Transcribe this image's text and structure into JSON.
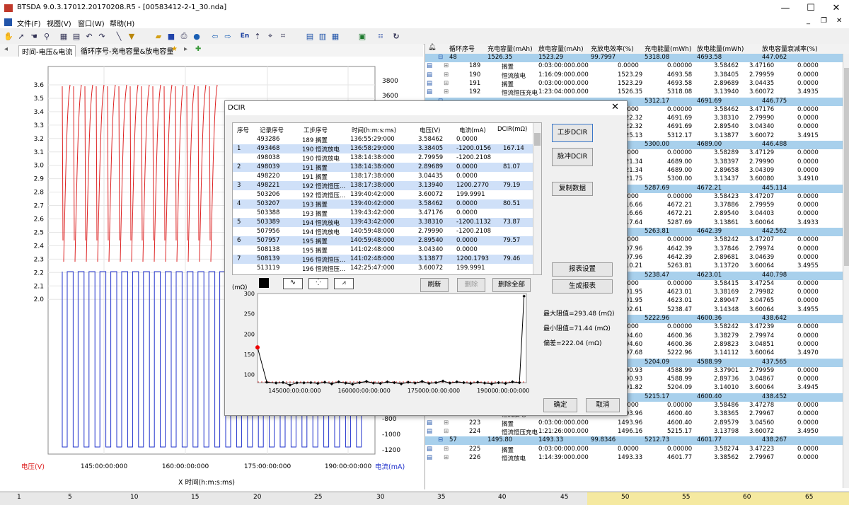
{
  "window": {
    "title": "BTSDA 9.0.3.17012.20170208.R5 - [00583412-2-1_30.nda]",
    "minimize": "—",
    "maximize": "☐",
    "close": "✕",
    "inner_minimize": "_",
    "inner_restore": "❐",
    "inner_close": "✕"
  },
  "menu": [
    "文件(F)",
    "视图(V)",
    "窗口(W)",
    "帮助(H)"
  ],
  "toolbar_icons": [
    "hand-icon",
    "pointer-icon",
    "hand2-icon",
    "zoom-icon",
    "grid-icon",
    "grid2-icon",
    "undo-icon",
    "redo-icon",
    "line-icon",
    "filter-icon",
    "open-icon",
    "save-icon",
    "print-icon",
    "help-icon",
    "back-icon",
    "forward-icon",
    "en-icon",
    "pin-icon",
    "cursor-icon",
    "cursor2-icon",
    "table-icon",
    "table2-icon",
    "table3-icon",
    "excel-icon",
    "dcir-icon",
    "refresh-icon"
  ],
  "toolbar_en": "En",
  "tabs": {
    "items": [
      "时间-电压&电流",
      "循环序号-充电容量&放电容量"
    ],
    "arrow_left": "◂",
    "arrow_right": "▸",
    "star": "★",
    "add": "✚"
  },
  "chart": {
    "left_axis_label": "电压(V)",
    "right_axis_label": "电流(mA)",
    "x_axis_label": "X  时间(h:m:s:ms)",
    "left_ticks": [
      "3.6",
      "3.5",
      "3.4",
      "3.3",
      "3.2",
      "3.1",
      "3.0",
      "2.9",
      "2.8",
      "2.7",
      "2.6",
      "2.5",
      "2.4",
      "2.3",
      "2.2",
      "2.1",
      "2.0"
    ],
    "right_ticks": [
      "3800",
      "3600",
      "-1000",
      "-1200"
    ],
    "right_ticks_bottom": [
      "-800",
      "-1000",
      "-1200"
    ],
    "x_ticks": [
      "145:00:00:000",
      "160:00:00:000",
      "175:00:00:000",
      "190:00:00:000"
    ]
  },
  "table": {
    "headers": [
      "循环序号",
      "充电容量(mAh)",
      "放电容量(mAh)",
      "充放电效率(%)",
      "充电能量(mWh)",
      "放电能量(mWh)",
      "放电容量衰减率(%)"
    ],
    "rows": [
      {
        "type": "grp",
        "c": [
          "48",
          "1526.35",
          "1523.29",
          "99.7997",
          "5318.08",
          "4693.58",
          "447.062"
        ]
      },
      {
        "type": "row",
        "c": [
          "189",
          "搁置",
          "0:03:00:000.000",
          "0.0000",
          "0.00000",
          "3.58462",
          "3.47160",
          "0.0000"
        ]
      },
      {
        "type": "row",
        "c": [
          "190",
          "恒流放电",
          "1:16:09:000.000",
          "1523.29",
          "4693.58",
          "3.38405",
          "2.79959",
          "0.0000"
        ]
      },
      {
        "type": "row",
        "c": [
          "191",
          "搁置",
          "0:03:00:000.000",
          "1523.29",
          "4693.58",
          "2.89689",
          "3.04435",
          "0.0000"
        ]
      },
      {
        "type": "row",
        "c": [
          "192",
          "恒流恒压充电",
          "1:23:04:000.000",
          "1526.35",
          "5318.08",
          "3.13940",
          "3.60072",
          "3.4935"
        ]
      },
      {
        "type": "grp",
        "c": [
          "",
          "",
          "",
          "5312.17",
          "4691.69",
          "446.775"
        ]
      },
      {
        "type": "row",
        "c": [
          "",
          "",
          "",
          "0.0000",
          "0.00000",
          "3.58462",
          "3.47176",
          "0.0000"
        ]
      },
      {
        "type": "row",
        "c": [
          "",
          "",
          "",
          "1522.32",
          "4691.69",
          "3.38310",
          "2.79990",
          "0.0000"
        ]
      },
      {
        "type": "row",
        "c": [
          "",
          "",
          "",
          "1522.32",
          "4691.69",
          "2.89540",
          "3.04340",
          "0.0000"
        ]
      },
      {
        "type": "row",
        "c": [
          "",
          "",
          "",
          "1525.13",
          "5312.17",
          "3.13877",
          "3.60072",
          "3.4915"
        ]
      },
      {
        "type": "grp",
        "c": [
          "",
          "",
          "",
          "5300.00",
          "4689.00",
          "446.488"
        ]
      },
      {
        "type": "row",
        "c": [
          "",
          "",
          "",
          "0.0000",
          "0.00000",
          "3.58289",
          "3.47129",
          "0.0000"
        ]
      },
      {
        "type": "row",
        "c": [
          "",
          "",
          "",
          "1521.34",
          "4689.00",
          "3.38397",
          "2.79990",
          "0.0000"
        ]
      },
      {
        "type": "row",
        "c": [
          "",
          "",
          "",
          "1521.34",
          "4689.00",
          "2.89658",
          "3.04309",
          "0.0000"
        ]
      },
      {
        "type": "row",
        "c": [
          "",
          "",
          "",
          "1521.75",
          "5300.00",
          "3.13437",
          "3.60080",
          "3.4910"
        ]
      },
      {
        "type": "grp",
        "c": [
          "",
          "",
          "",
          "5287.69",
          "4672.21",
          "445.114"
        ]
      },
      {
        "type": "row",
        "c": [
          "",
          "",
          "",
          "0.0000",
          "0.00000",
          "3.58423",
          "3.47207",
          "0.0000"
        ]
      },
      {
        "type": "row",
        "c": [
          "",
          "",
          "",
          "1516.66",
          "4672.21",
          "3.37886",
          "2.79959",
          "0.0000"
        ]
      },
      {
        "type": "row",
        "c": [
          "",
          "",
          "",
          "1516.66",
          "4672.21",
          "2.89540",
          "3.04403",
          "0.0000"
        ]
      },
      {
        "type": "row",
        "c": [
          "",
          "",
          "",
          "1517.64",
          "5287.69",
          "3.13861",
          "3.60064",
          "3.4933"
        ]
      },
      {
        "type": "grp",
        "c": [
          "",
          "",
          "",
          "5263.81",
          "4642.39",
          "442.562"
        ]
      },
      {
        "type": "row",
        "c": [
          "",
          "",
          "",
          "0.0000",
          "0.00000",
          "3.58242",
          "3.47207",
          "0.0000"
        ]
      },
      {
        "type": "row",
        "c": [
          "",
          "",
          "",
          "1507.96",
          "4642.39",
          "3.37846",
          "2.79974",
          "0.0000"
        ]
      },
      {
        "type": "row",
        "c": [
          "",
          "",
          "",
          "1507.96",
          "4642.39",
          "2.89681",
          "3.04639",
          "0.0000"
        ]
      },
      {
        "type": "row",
        "c": [
          "",
          "",
          "",
          "1510.21",
          "5263.81",
          "3.13720",
          "3.60064",
          "3.4955"
        ]
      },
      {
        "type": "grp",
        "c": [
          "",
          "",
          "",
          "5238.47",
          "4623.01",
          "440.798"
        ]
      },
      {
        "type": "row",
        "c": [
          "",
          "",
          "",
          "0.0000",
          "0.00000",
          "3.58415",
          "3.47254",
          "0.0000"
        ]
      },
      {
        "type": "row",
        "c": [
          "",
          "",
          "",
          "1501.95",
          "4623.01",
          "3.38169",
          "2.79982",
          "0.0000"
        ]
      },
      {
        "type": "row",
        "c": [
          "",
          "",
          "",
          "1501.95",
          "4623.01",
          "2.89047",
          "3.04765",
          "0.0000"
        ]
      },
      {
        "type": "row",
        "c": [
          "",
          "",
          "",
          "1502.61",
          "5238.47",
          "3.14348",
          "3.60064",
          "3.4955"
        ]
      },
      {
        "type": "grp",
        "c": [
          "",
          "",
          "",
          "5222.96",
          "4600.36",
          "438.642"
        ]
      },
      {
        "type": "row",
        "c": [
          "",
          "",
          "",
          "0.0000",
          "0.00000",
          "3.58242",
          "3.47239",
          "0.0000"
        ]
      },
      {
        "type": "row",
        "c": [
          "",
          "",
          "",
          "1494.60",
          "4600.36",
          "3.38279",
          "2.79974",
          "0.0000"
        ]
      },
      {
        "type": "row",
        "c": [
          "",
          "",
          "",
          "1494.60",
          "4600.36",
          "2.89823",
          "3.04851",
          "0.0000"
        ]
      },
      {
        "type": "row",
        "c": [
          "",
          "",
          "",
          "1497.68",
          "5222.96",
          "3.14112",
          "3.60064",
          "3.4970"
        ]
      },
      {
        "type": "grp",
        "c": [
          "",
          "",
          "",
          "5204.09",
          "4588.99",
          "437.565"
        ]
      },
      {
        "type": "row",
        "c": [
          "",
          "",
          "",
          "1490.93",
          "4588.99",
          "3.37901",
          "2.79959",
          "0.0000"
        ]
      },
      {
        "type": "row",
        "c": [
          "",
          "",
          "",
          "1490.93",
          "4588.99",
          "2.89736",
          "3.04867",
          "0.0000"
        ]
      },
      {
        "type": "row",
        "c": [
          "",
          "",
          "",
          "1491.82",
          "5204.09",
          "3.14010",
          "3.60064",
          "3.4945"
        ]
      },
      {
        "type": "grp",
        "c": [
          "",
          "",
          "",
          "5215.17",
          "4600.40",
          "438.452"
        ]
      },
      {
        "type": "row",
        "c": [
          "221",
          "搁置",
          "0:03:00:000.000",
          "0.0000",
          "0.00000",
          "3.58486",
          "3.47278",
          "0.0000"
        ]
      },
      {
        "type": "row",
        "c": [
          "222",
          "恒流放电",
          "1:14:41:000.000",
          "1493.96",
          "4600.40",
          "3.38365",
          "2.79967",
          "0.0000"
        ]
      },
      {
        "type": "row",
        "c": [
          "223",
          "搁置",
          "0:03:00:000.000",
          "1493.96",
          "4600.40",
          "2.89579",
          "3.04560",
          "0.0000"
        ]
      },
      {
        "type": "row",
        "c": [
          "224",
          "恒流恒压充电",
          "1:21:26:000.000",
          "1496.16",
          "5215.17",
          "3.13798",
          "3.60072",
          "3.4950"
        ]
      },
      {
        "type": "grp",
        "c": [
          "57",
          "1495.80",
          "1493.33",
          "99.8346",
          "5212.73",
          "4601.77",
          "438.267"
        ]
      },
      {
        "type": "row",
        "c": [
          "225",
          "搁置",
          "0:03:00:000.000",
          "0.0000",
          "0.00000",
          "3.58274",
          "3.47223",
          "0.0000"
        ]
      },
      {
        "type": "row",
        "c": [
          "226",
          "恒流放电",
          "1:14:39:000.000",
          "1493.33",
          "4601.77",
          "3.38562",
          "2.79967",
          "0.0000"
        ]
      }
    ]
  },
  "ruler": [
    "1",
    "5",
    "10",
    "15",
    "20",
    "25",
    "30",
    "35",
    "40",
    "45",
    "50",
    "55",
    "60",
    "65"
  ],
  "dialog": {
    "title": "DCIR",
    "close": "✕",
    "headers": [
      "序号",
      "记录序号",
      "工步序号",
      "时间(h:m:s:ms)",
      "电压(V)",
      "电流(mA)",
      "DCIR(mΩ)"
    ],
    "rows": [
      [
        "",
        "493286",
        "189 搁置",
        "136:55:29:000",
        "3.58462",
        "0.0000",
        ""
      ],
      [
        "1",
        "493468",
        "190 恒流放电",
        "136:58:29:000",
        "3.38405",
        "-1200.0156",
        "167.14"
      ],
      [
        "",
        "498038",
        "190 恒流放电",
        "138:14:38:000",
        "2.79959",
        "-1200.2108",
        ""
      ],
      [
        "2",
        "498039",
        "191 搁置",
        "138:14:38:000",
        "2.89689",
        "0.0000",
        "81.07"
      ],
      [
        "",
        "498220",
        "191 搁置",
        "138:17:38:000",
        "3.04435",
        "0.0000",
        ""
      ],
      [
        "3",
        "498221",
        "192 恒流恒压...",
        "138:17:38:000",
        "3.13940",
        "1200.2770",
        "79.19"
      ],
      [
        "",
        "503206",
        "192 恒流恒压...",
        "139:40:42:000",
        "3.60072",
        "199.9991",
        ""
      ],
      [
        "4",
        "503207",
        "193 搁置",
        "139:40:42:000",
        "3.58462",
        "0.0000",
        "80.51"
      ],
      [
        "",
        "503388",
        "193 搁置",
        "139:43:42:000",
        "3.47176",
        "0.0000",
        ""
      ],
      [
        "5",
        "503389",
        "194 恒流放电",
        "139:43:42:000",
        "3.38310",
        "-1200.1132",
        "73.87"
      ],
      [
        "",
        "507956",
        "194 恒流放电",
        "140:59:48:000",
        "2.79990",
        "-1200.2108",
        ""
      ],
      [
        "6",
        "507957",
        "195 搁置",
        "140:59:48:000",
        "2.89540",
        "0.0000",
        "79.57"
      ],
      [
        "",
        "508138",
        "195 搁置",
        "141:02:48:000",
        "3.04340",
        "0.0000",
        ""
      ],
      [
        "7",
        "508139",
        "196 恒流恒压...",
        "141:02:48:000",
        "3.13877",
        "1200.1793",
        "79.46"
      ],
      [
        "",
        "513119",
        "196 恒流恒压...",
        "142:25:47:000",
        "3.60072",
        "199.9991",
        ""
      ]
    ],
    "buttons": {
      "step_dcir": "工步DCIR",
      "pulse_dcir": "脉冲DCIR",
      "copy": "复制数据",
      "report_settings": "报表设置",
      "generate_report": "生成报表",
      "refresh": "刷新",
      "delete": "删除",
      "delete_all": "删除全部",
      "ok": "确定",
      "cancel": "取消"
    },
    "plot_unit": "(mΩ)",
    "plot_yticks": [
      "300",
      "250",
      "200",
      "150",
      "100"
    ],
    "plot_xticks": [
      "145000:00:00:000",
      "160000:00:00:000",
      "175000:00:00:000",
      "190000:00:00:000"
    ],
    "stats": {
      "max": "最大阻值=293.48 (mΩ)",
      "min": "最小阻值=71.44 (mΩ)",
      "range": "偏差=222.04 (mΩ)"
    }
  },
  "chart_data": {
    "type": "line",
    "title": "",
    "xlabel": "",
    "ylabel": "(mΩ)",
    "ylim": [
      80,
      300
    ],
    "xlim": [
      137000,
      195000
    ],
    "series": [
      {
        "x": [
          137000,
          139000,
          141000,
          142500,
          144000,
          145500,
          147000,
          148500,
          150000,
          151500,
          153000,
          154500,
          156000,
          157500,
          159000,
          160500,
          162000,
          163500,
          165000,
          166500,
          168000,
          169500,
          171000,
          172500,
          174000,
          175500,
          177000,
          178500,
          180000,
          181500,
          183000,
          184500,
          186000,
          187500,
          189000,
          190500,
          192000,
          193500,
          194500
        ],
        "values": [
          167.14,
          81.07,
          79.19,
          80.51,
          73.87,
          79.57,
          79.46,
          80,
          78,
          81,
          77,
          82,
          79,
          76,
          80,
          83,
          79,
          78,
          82,
          80,
          77,
          81,
          79,
          83,
          78,
          80,
          84,
          79,
          82,
          80,
          78,
          81,
          79,
          77,
          80,
          78,
          82,
          80,
          293.48
        ]
      }
    ],
    "highlight_point": {
      "x": 137000,
      "y": 167.14
    }
  }
}
